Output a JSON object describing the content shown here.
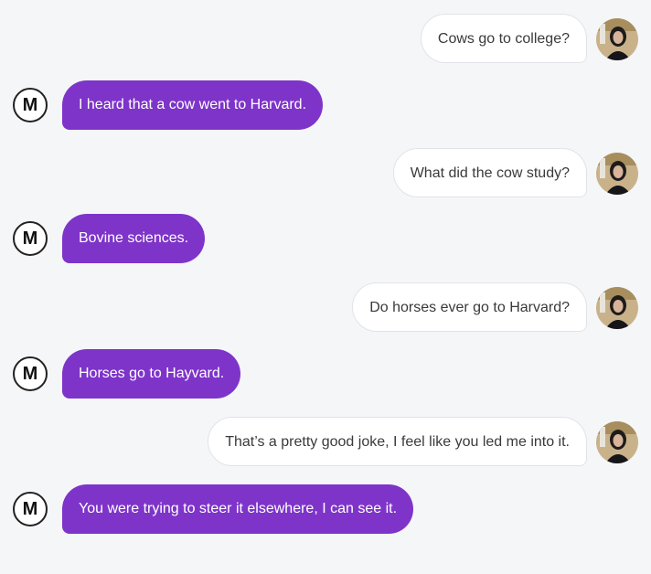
{
  "bot": {
    "avatar_letter": "M",
    "avatar_icon": "letter-m-avatar"
  },
  "user": {
    "avatar_icon": "user-photo-avatar"
  },
  "colors": {
    "bot_bubble": "#7e34c9",
    "user_bubble": "#ffffff",
    "background": "#f5f6f8"
  },
  "messages": [
    {
      "sender": "user",
      "text": "Cows go to college?"
    },
    {
      "sender": "bot",
      "text": "I heard that a cow went to Harvard."
    },
    {
      "sender": "user",
      "text": "What did the cow study?"
    },
    {
      "sender": "bot",
      "text": "Bovine sciences."
    },
    {
      "sender": "user",
      "text": "Do horses ever go to Harvard?"
    },
    {
      "sender": "bot",
      "text": "Horses go to Hayvard."
    },
    {
      "sender": "user",
      "text": "That’s a pretty good joke, I feel like you led me into it."
    },
    {
      "sender": "bot",
      "text": "You were trying to steer it elsewhere, I can see it."
    }
  ]
}
